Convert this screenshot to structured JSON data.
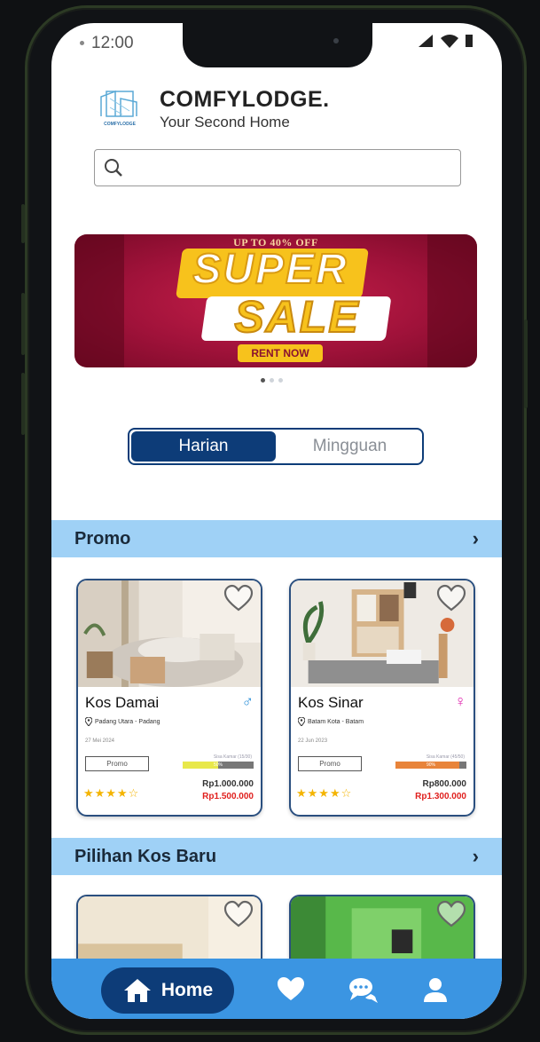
{
  "status": {
    "time": "12:00"
  },
  "brand": {
    "title": "COMFYLODGE.",
    "tagline": "Your Second Home",
    "logo_text": "COMFYLODGE"
  },
  "search": {
    "placeholder": ""
  },
  "banner": {
    "top_text": "UP TO 40% OFF",
    "line1": "SUPER",
    "line2": "SALE",
    "cta": "RENT NOW",
    "slide_index": 1,
    "slide_count": 3
  },
  "period_toggle": {
    "options": [
      "Harian",
      "Mingguan"
    ],
    "selected": "Harian"
  },
  "sections": {
    "promo": {
      "title": "Promo",
      "chevron": "›"
    },
    "new": {
      "title": "Pilihan Kos Baru",
      "chevron": "›"
    }
  },
  "promo_cards": [
    {
      "name": "Kos Damai",
      "gender_icon": "male-icon",
      "gender_symbol": "♂",
      "gender_color": "#2a8fd8",
      "location": "Padang Utara - Padang",
      "date": "27 Mei 2024",
      "tag": "Promo",
      "rooms_left_label": "Sisa Kamar (15/30)",
      "rooms_fraction": 0.5,
      "rooms_pct": "50%",
      "bar_color": "#e8e84a",
      "stars": "★★★★☆",
      "price": "Rp1.000.000",
      "price_old": "Rp1.500.000"
    },
    {
      "name": "Kos Sinar",
      "gender_icon": "female-icon",
      "gender_symbol": "♀",
      "gender_color": "#e02ab0",
      "location": "Batam Kota - Batam",
      "date": "22 Jun 2023",
      "tag": "Promo",
      "rooms_left_label": "Sisa Kamar (45/50)",
      "rooms_fraction": 0.9,
      "rooms_pct": "90%",
      "bar_color": "#e8843a",
      "stars": "★★★★☆",
      "price": "Rp800.000",
      "price_old": "Rp1.300.000"
    }
  ],
  "nav": {
    "home_label": "Home",
    "items": [
      "home-icon",
      "heart-icon",
      "chat-icon",
      "profile-icon"
    ],
    "active": "home"
  },
  "colors": {
    "primary": "#0d3c78",
    "nav_bg": "#3b95e2",
    "section_bg": "#9fd1f6",
    "price_old": "#e0201e",
    "star": "#f4b400"
  }
}
